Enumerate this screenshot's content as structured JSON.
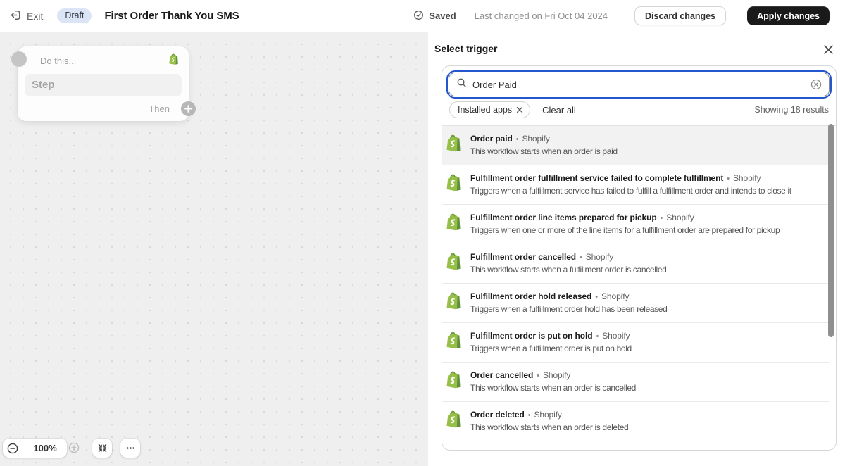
{
  "colors": {
    "shopify_green": "#95BF47",
    "shopify_green_dark": "#5E8E3E",
    "focus_ring_blue": "#2257cf",
    "draft_badge_bg": "#dbe5f5",
    "apply_button_bg": "#1a1a1a",
    "selected_row_bg": "#f2f2f2"
  },
  "topbar": {
    "exit_label": "Exit",
    "status_badge": "Draft",
    "title": "First Order Thank You SMS",
    "saved_label": "Saved",
    "last_changed": "Last changed on Fri Oct 04 2024",
    "discard_label": "Discard changes",
    "apply_label": "Apply changes"
  },
  "canvas": {
    "card": {
      "header": "Do this...",
      "step_label": "Step",
      "then_label": "Then"
    },
    "zoom_level": "100%"
  },
  "panel": {
    "title": "Select trigger",
    "search": {
      "value": "Order Paid"
    },
    "filters": {
      "chip": "Installed apps",
      "clear_all": "Clear all",
      "results_count": "Showing 18 results"
    },
    "separator": "•",
    "triggers": [
      {
        "title": "Order paid",
        "source": "Shopify",
        "description": "This workflow starts when an order is paid",
        "selected": true
      },
      {
        "title": "Fulfillment order fulfillment service failed to complete fulfillment",
        "source": "Shopify",
        "description": "Triggers when a fulfillment service has failed to fulfill a fulfillment order and intends to close it",
        "selected": false
      },
      {
        "title": "Fulfillment order line items prepared for pickup",
        "source": "Shopify",
        "description": "Triggers when one or more of the line items for a fulfillment order are prepared for pickup",
        "selected": false
      },
      {
        "title": "Fulfillment order cancelled",
        "source": "Shopify",
        "description": "This workflow starts when a fulfillment order is cancelled",
        "selected": false
      },
      {
        "title": "Fulfillment order hold released",
        "source": "Shopify",
        "description": "Triggers when a fulfillment order hold has been released",
        "selected": false
      },
      {
        "title": "Fulfillment order is put on hold",
        "source": "Shopify",
        "description": "Triggers when a fulfillment order is put on hold",
        "selected": false
      },
      {
        "title": "Order cancelled",
        "source": "Shopify",
        "description": "This workflow starts when an order is cancelled",
        "selected": false
      },
      {
        "title": "Order deleted",
        "source": "Shopify",
        "description": "This workflow starts when an order is deleted",
        "selected": false
      }
    ]
  }
}
